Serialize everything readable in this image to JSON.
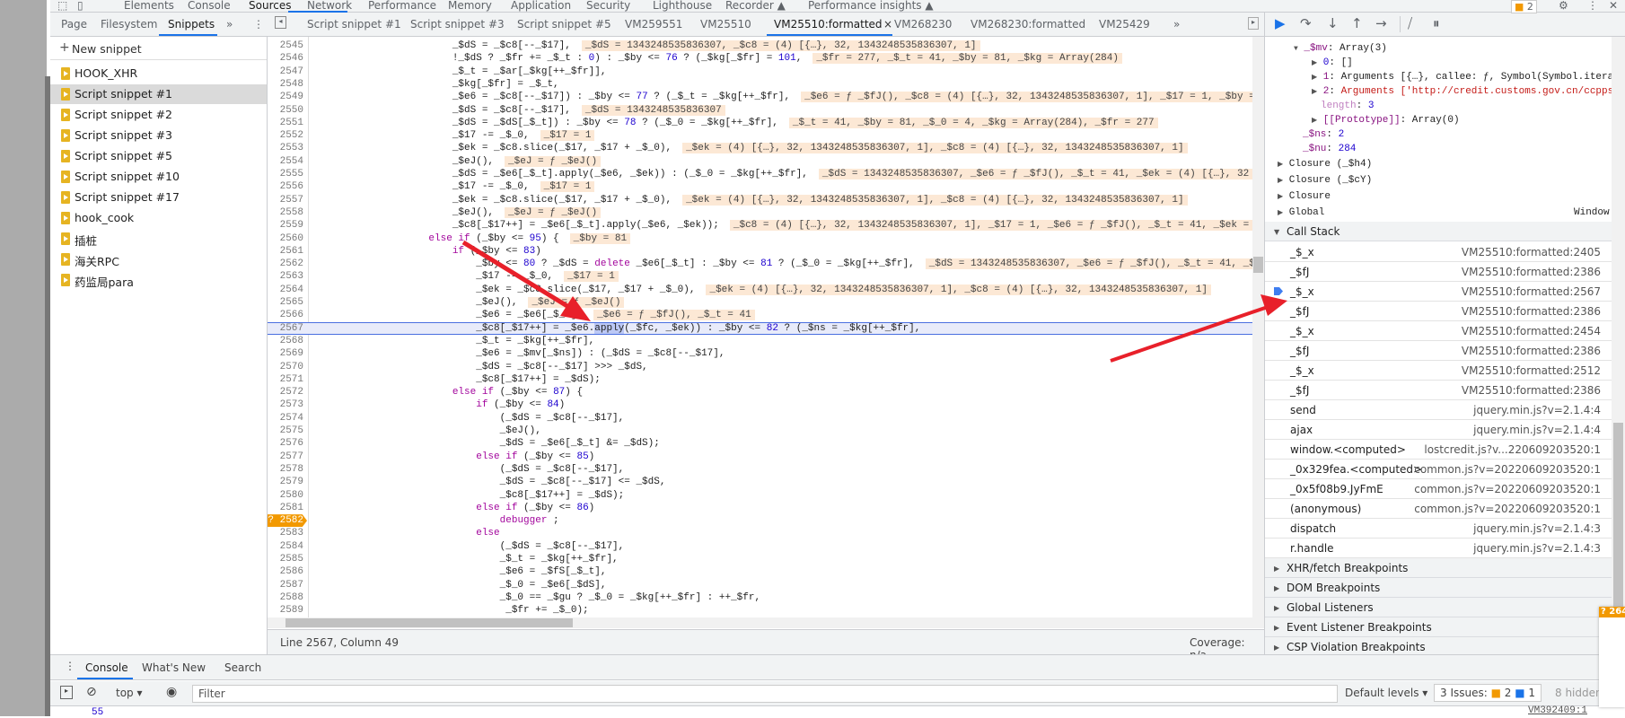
{
  "top_tabs": [
    "Elements",
    "Console",
    "Sources",
    "Network",
    "Performance",
    "Memory",
    "Application",
    "Security",
    "Lighthouse",
    "Recorder ▲",
    "Performance insights ▲"
  ],
  "active_top_tab": "Sources",
  "issues_badge": "2",
  "navigator": {
    "tabs": [
      "Page",
      "Filesystem",
      "Snippets"
    ],
    "active_tab": "Snippets",
    "more": "»",
    "new_snippet": "New snippet",
    "snippets": [
      "HOOK_XHR",
      "Script snippet #1",
      "Script snippet #2",
      "Script snippet #3",
      "Script snippet #5",
      "Script snippet #10",
      "Script snippet #17",
      "hook_cook",
      "插桩",
      "海关RPC",
      "药监局para"
    ],
    "selected": "Script snippet #1"
  },
  "editor_tabs": [
    "Script snippet #1",
    "Script snippet #3",
    "Script snippet #5",
    "VM259551",
    "VM25510",
    "VM25510:formatted",
    "VM268230",
    "VM268230:formatted",
    "VM25429"
  ],
  "active_editor_tab": "VM25510:formatted",
  "editor_more": "»",
  "code": {
    "current_line": 2567,
    "breakpoint_line": 2582,
    "breakpoint_label": "? 2582",
    "lines": [
      {
        "num": "2545",
        "parts": [
          [
            "p",
            "                       _$dS = _$c8[--_$17],"
          ]
        ],
        "inline": "_$dS = 1343248535836307, _$c8 = (4) [{…}, 32, 1343248535836307, 1]"
      },
      {
        "num": "2546",
        "parts": [
          [
            "p",
            "                       !_$dS ? _$fr += _$_t : "
          ],
          [
            "n",
            "0"
          ],
          [
            "p",
            ") : _$by <= "
          ],
          [
            "n",
            "76"
          ],
          [
            "p",
            " ? (_$kg[_$fr] = "
          ],
          [
            "n",
            "101"
          ],
          [
            "p",
            ","
          ]
        ],
        "inline": "_$fr = 277, _$_t = 41, _$by = 81, _$kg = Array(284)"
      },
      {
        "num": "2547",
        "parts": [
          [
            "p",
            "                       _$_t = _$ar[_$kg[++_$fr]],"
          ]
        ]
      },
      {
        "num": "2548",
        "parts": [
          [
            "p",
            "                       _$kg[_$fr] = _$_t,"
          ]
        ]
      },
      {
        "num": "2549",
        "parts": [
          [
            "p",
            "                       _$e6 = _$c8[--_$17]) : _$by <= "
          ],
          [
            "n",
            "77"
          ],
          [
            "p",
            " ? (_$_t = _$kg[++_$fr],"
          ]
        ],
        "inline": "_$e6 = ƒ _$fJ(), _$c8 = (4) [{…}, 32, 1343248535836307, 1], _$17 = 1, _$by = 81"
      },
      {
        "num": "2550",
        "parts": [
          [
            "p",
            "                       _$dS = _$c8[--_$17],"
          ]
        ],
        "inline": "_$dS = 1343248535836307"
      },
      {
        "num": "2551",
        "parts": [
          [
            "p",
            "                       _$dS = _$dS[_$_t]) : _$by <= "
          ],
          [
            "n",
            "78"
          ],
          [
            "p",
            " ? (_$_0 = _$kg[++_$fr],"
          ]
        ],
        "inline": "_$_t = 41, _$by = 81, _$_0 = 4, _$kg = Array(284), _$fr = 277"
      },
      {
        "num": "2552",
        "parts": [
          [
            "p",
            "                       _$17 -= _$_0,"
          ]
        ],
        "inline": "_$17 = 1"
      },
      {
        "num": "2553",
        "parts": [
          [
            "p",
            "                       _$ek = _$c8.slice(_$17, _$17 + _$_0),"
          ]
        ],
        "inline": "_$ek = (4) [{…}, 32, 1343248535836307, 1], _$c8 = (4) [{…}, 32, 1343248535836307, 1]"
      },
      {
        "num": "2554",
        "parts": [
          [
            "p",
            "                       _$eJ(),"
          ]
        ],
        "inline": "_$eJ = ƒ _$eJ()"
      },
      {
        "num": "2555",
        "parts": [
          [
            "p",
            "                       _$dS = _$e6[_$_t].apply(_$e6, _$ek)) : (_$_0 = _$kg[++_$fr],"
          ]
        ],
        "inline": "_$dS = 1343248535836307, _$e6 = ƒ _$fJ(), _$_t = 41, _$ek = (4) [{…}, 32"
      },
      {
        "num": "2556",
        "parts": [
          [
            "p",
            "                       _$17 -= _$_0,"
          ]
        ],
        "inline": "_$17 = 1"
      },
      {
        "num": "2557",
        "parts": [
          [
            "p",
            "                       _$ek = _$c8.slice(_$17, _$17 + _$_0),"
          ]
        ],
        "inline": "_$ek = (4) [{…}, 32, 1343248535836307, 1], _$c8 = (4) [{…}, 32, 1343248535836307, 1]"
      },
      {
        "num": "2558",
        "parts": [
          [
            "p",
            "                       _$eJ(),"
          ]
        ],
        "inline": "_$eJ = ƒ _$eJ()"
      },
      {
        "num": "2559",
        "parts": [
          [
            "p",
            "                       _$c8[_$17++] = _$e6[_$_t].apply(_$e6, _$ek));"
          ]
        ],
        "inline": "_$c8 = (4) [{…}, 32, 1343248535836307, 1], _$17 = 1, _$e6 = ƒ _$fJ(), _$_t = 41, _$ek ="
      },
      {
        "num": "2560",
        "parts": [
          [
            "p",
            "                   "
          ],
          [
            "k",
            "else if"
          ],
          [
            "p",
            " (_$by <= "
          ],
          [
            "n",
            "95"
          ],
          [
            "p",
            ") {"
          ]
        ],
        "inline": "_$by = 81"
      },
      {
        "num": "2561",
        "parts": [
          [
            "p",
            "                       "
          ],
          [
            "k",
            "if"
          ],
          [
            "p",
            " (_$by <= "
          ],
          [
            "n",
            "83"
          ],
          [
            "p",
            ")"
          ]
        ]
      },
      {
        "num": "2562",
        "parts": [
          [
            "p",
            "                           _$by <= "
          ],
          [
            "n",
            "80"
          ],
          [
            "p",
            " ? _$dS = "
          ],
          [
            "k",
            "delete"
          ],
          [
            "p",
            " _$e6[_$_t] : _$by <= "
          ],
          [
            "n",
            "81"
          ],
          [
            "p",
            " ? (_$_0 = _$kg[++_$fr],"
          ]
        ],
        "inline": "_$dS = 1343248535836307, _$e6 = ƒ _$fJ(), _$_t = 41, _$"
      },
      {
        "num": "2563",
        "parts": [
          [
            "p",
            "                           _$17 -= _$_0,"
          ]
        ],
        "inline": "_$17 = 1"
      },
      {
        "num": "2564",
        "parts": [
          [
            "p",
            "                           _$ek = _$c8.slice(_$17, _$17 + _$_0),"
          ]
        ],
        "inline": "_$ek = (4) [{…}, 32, 1343248535836307, 1], _$c8 = (4) [{…}, 32, 1343248535836307, 1]"
      },
      {
        "num": "2565",
        "parts": [
          [
            "p",
            "                           _$eJ(),"
          ]
        ],
        "inline": "_$eJ = ƒ _$eJ()"
      },
      {
        "num": "2566",
        "parts": [
          [
            "p",
            "                           _$e6 = _$e6[_$_t],"
          ]
        ],
        "inline": "_$e6 = ƒ _$fJ(), _$_t = 41"
      },
      {
        "num": "2567",
        "parts": [
          [
            "p",
            "                           _$c8[_$17++] = _$e6."
          ],
          [
            "s",
            "apply"
          ],
          [
            "p",
            "(_$fc, _$ek)) : _$by <= "
          ],
          [
            "n",
            "82"
          ],
          [
            "p",
            " ? (_$ns = _$kg[++_$fr],"
          ]
        ]
      },
      {
        "num": "2568",
        "parts": [
          [
            "p",
            "                           _$_t = _$kg[++_$fr],"
          ]
        ]
      },
      {
        "num": "2569",
        "parts": [
          [
            "p",
            "                           _$e6 = _$mv[_$ns]) : (_$dS = _$c8[--_$17],"
          ]
        ]
      },
      {
        "num": "2570",
        "parts": [
          [
            "p",
            "                           _$dS = _$c8[--_$17] >>> _$dS,"
          ]
        ]
      },
      {
        "num": "2571",
        "parts": [
          [
            "p",
            "                           _$c8[_$17++] = _$dS);"
          ]
        ]
      },
      {
        "num": "2572",
        "parts": [
          [
            "p",
            "                       "
          ],
          [
            "k",
            "else if"
          ],
          [
            "p",
            " (_$by <= "
          ],
          [
            "n",
            "87"
          ],
          [
            "p",
            ") {"
          ]
        ]
      },
      {
        "num": "2573",
        "parts": [
          [
            "p",
            "                           "
          ],
          [
            "k",
            "if"
          ],
          [
            "p",
            " (_$by <= "
          ],
          [
            "n",
            "84"
          ],
          [
            "p",
            ")"
          ]
        ]
      },
      {
        "num": "2574",
        "parts": [
          [
            "p",
            "                               (_$dS = _$c8[--_$17],"
          ]
        ]
      },
      {
        "num": "2575",
        "parts": [
          [
            "p",
            "                               _$eJ(),"
          ]
        ]
      },
      {
        "num": "2576",
        "parts": [
          [
            "p",
            "                               _$dS = _$e6[_$_t] &= _$dS);"
          ]
        ]
      },
      {
        "num": "2577",
        "parts": [
          [
            "p",
            "                           "
          ],
          [
            "k",
            "else if"
          ],
          [
            "p",
            " (_$by <= "
          ],
          [
            "n",
            "85"
          ],
          [
            "p",
            ")"
          ]
        ]
      },
      {
        "num": "2578",
        "parts": [
          [
            "p",
            "                               (_$dS = _$c8[--_$17],"
          ]
        ]
      },
      {
        "num": "2579",
        "parts": [
          [
            "p",
            "                               _$dS = _$c8[--_$17] <= _$dS,"
          ]
        ]
      },
      {
        "num": "2580",
        "parts": [
          [
            "p",
            "                               _$c8[_$17++] = _$dS);"
          ]
        ]
      },
      {
        "num": "2581",
        "parts": [
          [
            "p",
            "                           "
          ],
          [
            "k",
            "else if"
          ],
          [
            "p",
            " (_$by <= "
          ],
          [
            "n",
            "86"
          ],
          [
            "p",
            ")"
          ]
        ]
      },
      {
        "num": "2582",
        "parts": [
          [
            "p",
            "                               "
          ],
          [
            "k",
            "debugger"
          ],
          [
            "p",
            " ;"
          ]
        ]
      },
      {
        "num": "2583",
        "parts": [
          [
            "p",
            "                           "
          ],
          [
            "k",
            "else"
          ]
        ]
      },
      {
        "num": "2584",
        "parts": [
          [
            "p",
            "                               (_$dS = _$c8[--_$17],"
          ]
        ]
      },
      {
        "num": "2585",
        "parts": [
          [
            "p",
            "                               _$_t = _$kg[++_$fr],"
          ]
        ]
      },
      {
        "num": "2586",
        "parts": [
          [
            "p",
            "                               _$e6 = _$fS[_$_t],"
          ]
        ]
      },
      {
        "num": "2587",
        "parts": [
          [
            "p",
            "                               _$_0 = _$e6[_$dS],"
          ]
        ]
      },
      {
        "num": "2588",
        "parts": [
          [
            "p",
            "                               _$_0 == _$gu ? _$_0 = _$kg[++_$fr] : ++_$fr,"
          ]
        ]
      },
      {
        "num": "2589",
        "parts": [
          [
            "p",
            "                                _$fr += _$_0);"
          ]
        ]
      }
    ]
  },
  "status": {
    "position": "Line 2567, Column 49",
    "coverage": "Coverage: n/a"
  },
  "scope": {
    "rows": [
      {
        "tri": "▼",
        "name": "_$mv",
        "sep": ": ",
        "value": "Array(3)",
        "vclass": ""
      },
      {
        "tri": "▶",
        "name": "0",
        "sep": ": ",
        "value": "[]",
        "vclass": "",
        "nclass": "pv"
      },
      {
        "tri": "▶",
        "name": "1",
        "sep": ": ",
        "value": "Arguments [{…}, callee: ƒ, Symbol(Symbol.iterator)",
        "vclass": ""
      },
      {
        "tri": "▶",
        "name": "2",
        "sep": ": ",
        "value": "Arguments ['http://credit.customs.gov.cn/ccppserve",
        "vclass": "ps"
      },
      {
        "tri": "",
        "name": "length",
        "sep": ": ",
        "value": "3",
        "vclass": "pv",
        "nclass": "pl"
      },
      {
        "tri": "▶",
        "name": "[[Prototype]]",
        "sep": ": ",
        "value": "Array(0)",
        "vclass": ""
      },
      {
        "tri": "",
        "name": "_$ns",
        "sep": ": ",
        "value": "2",
        "vclass": "pv"
      },
      {
        "tri": "",
        "name": "_$nu",
        "sep": ": ",
        "value": "284",
        "vclass": "pv"
      }
    ],
    "closures": [
      "Closure (_$h4)",
      "Closure (_$cY)",
      "Closure",
      "Global"
    ],
    "global_value": "Window"
  },
  "call_stack": {
    "title": "Call Stack",
    "current_index": 2,
    "frames": [
      {
        "fn": "_$_x",
        "loc": "VM25510:formatted:2405"
      },
      {
        "fn": "_$fJ",
        "loc": "VM25510:formatted:2386"
      },
      {
        "fn": "_$_x",
        "loc": "VM25510:formatted:2567"
      },
      {
        "fn": "_$fJ",
        "loc": "VM25510:formatted:2386"
      },
      {
        "fn": "_$_x",
        "loc": "VM25510:formatted:2454"
      },
      {
        "fn": "_$fJ",
        "loc": "VM25510:formatted:2386"
      },
      {
        "fn": "_$_x",
        "loc": "VM25510:formatted:2512"
      },
      {
        "fn": "_$fJ",
        "loc": "VM25510:formatted:2386"
      },
      {
        "fn": "send",
        "loc": "jquery.min.js?v=2.1.4:4"
      },
      {
        "fn": "ajax",
        "loc": "jquery.min.js?v=2.1.4:4"
      },
      {
        "fn": "window.<computed>",
        "loc": "lostcredit.js?v...220609203520:1"
      },
      {
        "fn": "_0x329fea.<computed>",
        "loc": "common.js?v=20220609203520:1"
      },
      {
        "fn": "_0x5f08b9.JyFmE",
        "loc": "common.js?v=20220609203520:1"
      },
      {
        "fn": "(anonymous)",
        "loc": "common.js?v=20220609203520:1"
      },
      {
        "fn": "dispatch",
        "loc": "jquery.min.js?v=2.1.4:3"
      },
      {
        "fn": "r.handle",
        "loc": "jquery.min.js?v=2.1.4:3"
      }
    ]
  },
  "breakpoint_sections": [
    "XHR/fetch Breakpoints",
    "DOM Breakpoints",
    "Global Listeners",
    "Event Listener Breakpoints",
    "CSP Violation Breakpoints"
  ],
  "drawer": {
    "tabs": [
      "Console",
      "What's New",
      "Search"
    ],
    "active_tab": "Console",
    "context": "top",
    "filter_placeholder": "Filter",
    "levels": "Default levels",
    "issues_label": "3 Issues:",
    "issues_warn": "2",
    "issues_info": "1",
    "hidden": "8 hidden",
    "output_value": "55",
    "output_source": "VM392409:1"
  },
  "overlay_tag": "? 264",
  "colors": {
    "accent": "#1a73e8",
    "inline_value_bg": "#fce8d5",
    "breakpoint": "#f29900",
    "arrow": "#e8202a"
  }
}
